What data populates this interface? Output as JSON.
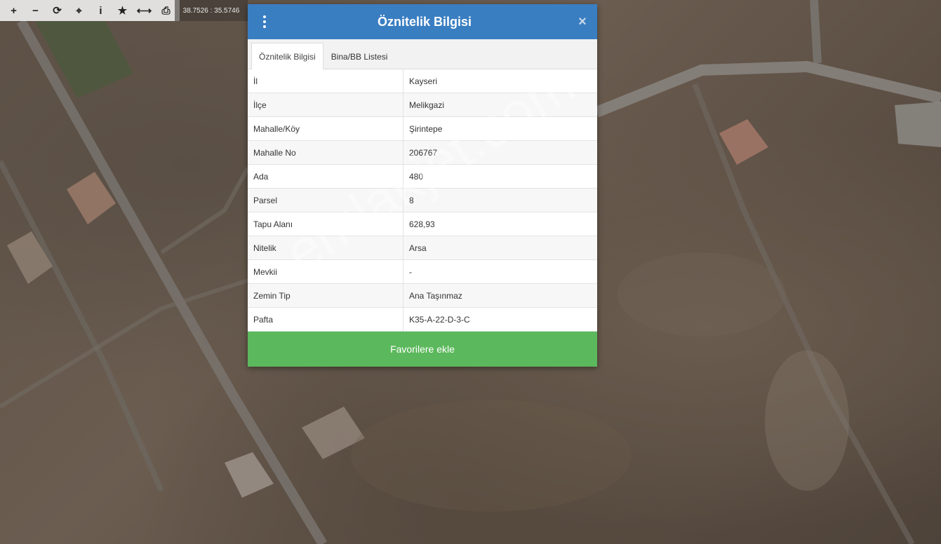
{
  "toolbar": {
    "items": [
      {
        "name": "zoom-in",
        "glyph": "+"
      },
      {
        "name": "zoom-out",
        "glyph": "−"
      },
      {
        "name": "refresh",
        "glyph": "⟳"
      },
      {
        "name": "locate",
        "glyph": "⌖"
      },
      {
        "name": "info",
        "glyph": "i"
      },
      {
        "name": "favorite",
        "glyph": "★"
      },
      {
        "name": "measure",
        "glyph": "⟷"
      },
      {
        "name": "print",
        "glyph": "⎙"
      }
    ],
    "coords": "38.7526 : 35.5746"
  },
  "dialog": {
    "title": "Öznitelik Bilgisi",
    "close_glyph": "×",
    "tabs": [
      {
        "label": "Öznitelik Bilgisi",
        "active": true
      },
      {
        "label": "Bina/BB Listesi",
        "active": false
      }
    ],
    "rows": [
      {
        "key": "İl",
        "value": "Kayseri"
      },
      {
        "key": "İlçe",
        "value": "Melikgazi"
      },
      {
        "key": "Mahalle/Köy",
        "value": "Şirintepe"
      },
      {
        "key": "Mahalle No",
        "value": "206767"
      },
      {
        "key": "Ada",
        "value": "480"
      },
      {
        "key": "Parsel",
        "value": "8"
      },
      {
        "key": "Tapu Alanı",
        "value": "628,93"
      },
      {
        "key": "Nitelik",
        "value": "Arsa"
      },
      {
        "key": "Mevkii",
        "value": "-"
      },
      {
        "key": "Zemin Tip",
        "value": "Ana Taşınmaz"
      },
      {
        "key": "Pafta",
        "value": "K35-A-22-D-3-C"
      }
    ],
    "favorite_label": "Favorilere ekle"
  },
  "watermark": "emlakjet.com",
  "colors": {
    "header": "#3a7ec2",
    "favorite": "#5cb85c"
  }
}
